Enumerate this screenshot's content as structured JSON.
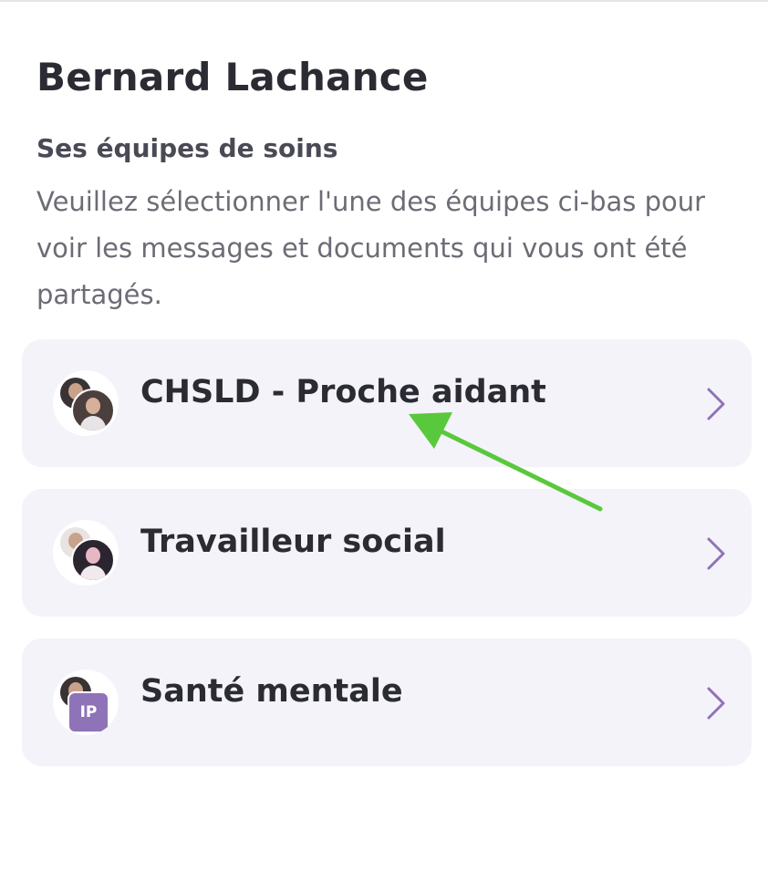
{
  "header": {
    "title": "Bernard Lachance"
  },
  "section": {
    "title": "Ses équipes de soins",
    "description": "Veuillez sélectionner l'une des équipes ci-bas pour voir les messages et documents qui vous ont été partagés."
  },
  "teams": [
    {
      "name": "CHSLD - Proche aidant"
    },
    {
      "name": "Travailleur social"
    },
    {
      "name": "Santé mentale",
      "avatar_initials": "IP"
    }
  ],
  "colors": {
    "accent": "#8f73b8",
    "card_background": "#f4f3f9",
    "chevron": "#8f73b8",
    "annotation_arrow": "#5ac83c"
  },
  "icons": {
    "chevron": "chevron-right-icon",
    "annotation": "arrow-annotation-icon"
  }
}
